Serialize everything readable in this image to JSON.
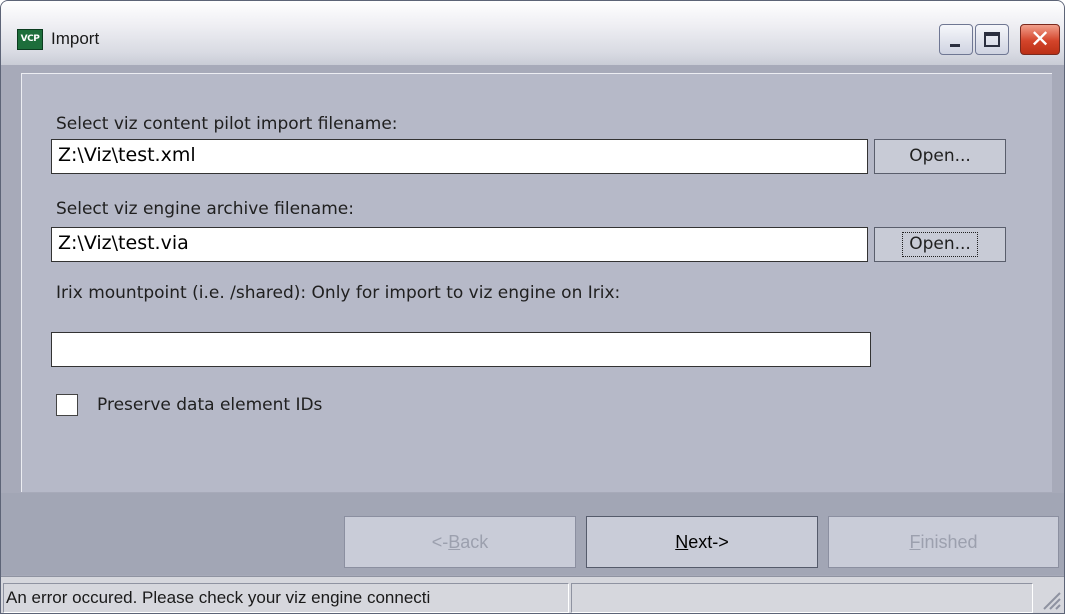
{
  "window": {
    "title": "Import",
    "app_icon_label": "VCP"
  },
  "controls": {
    "close_glyph": "✕"
  },
  "form": {
    "vcp_label": "Select viz content pilot import filename:",
    "vcp_value": "Z:\\Viz\\test.xml",
    "vcp_open_label": "Open...",
    "via_label": "Select viz engine archive filename:",
    "via_value": "Z:\\Viz\\test.via",
    "via_open_label": "Open...",
    "irix_label": "Irix mountpoint (i.e. /shared): Only for import to viz engine on Irix:",
    "irix_value": "",
    "preserve_checked": false,
    "preserve_label": "Preserve data element IDs"
  },
  "nav": {
    "back_prefix": "<-",
    "back_mnemonic": "B",
    "back_rest": "ack",
    "back_enabled": false,
    "next_mnemonic": "N",
    "next_rest": "ext->",
    "next_enabled": true,
    "finished_mnemonic": "F",
    "finished_rest": "inished",
    "finished_enabled": false
  },
  "status": {
    "message": "An error occured. Please check your viz engine connecti",
    "secondary": ""
  },
  "icons": {
    "app": "vcp-app-icon",
    "minimize": "minimize-icon",
    "maximize": "maximize-icon",
    "close": "close-icon",
    "grip": "resize-grip-icon"
  },
  "colors": {
    "window_bg": "#a7aab9",
    "panel_bg": "#b6b9c8",
    "close_button": "#d3442a",
    "disabled_text": "#9ca0ae"
  }
}
